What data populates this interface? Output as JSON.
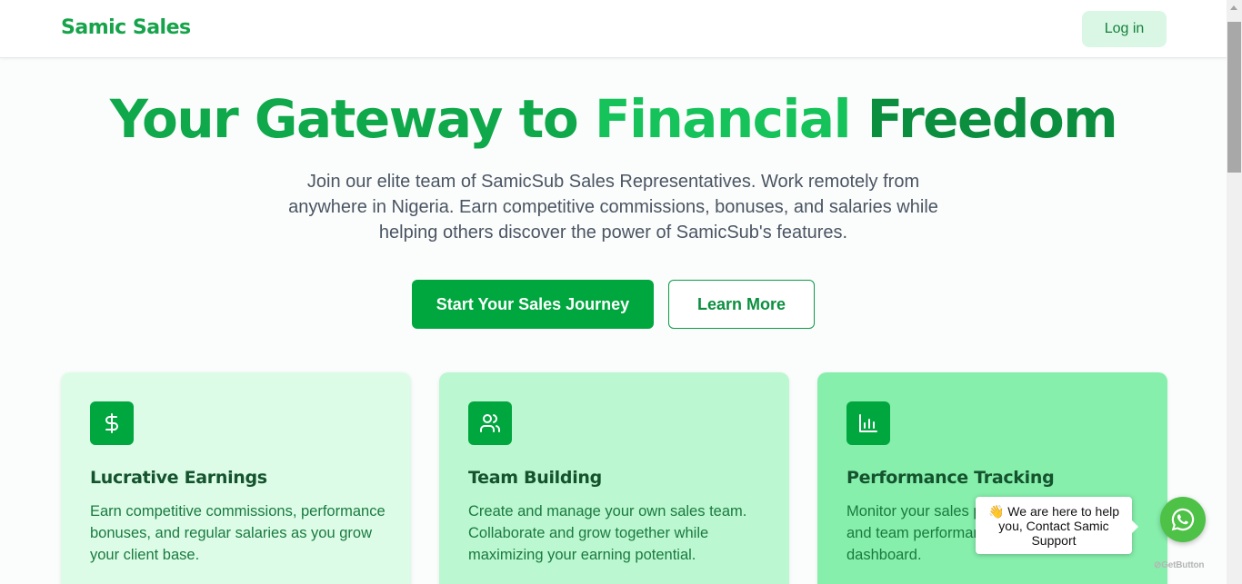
{
  "header": {
    "brand": "Samic Sales",
    "login_label": "Log in"
  },
  "hero": {
    "title_part1": "Your Gateway to ",
    "title_part2": "Financial",
    "title_part3": " Freedom",
    "subtitle": "Join our elite team of SamicSub Sales Representatives. Work remotely from anywhere in Nigeria. Earn competitive commissions, bonuses, and salaries while helping others discover the power of SamicSub's features.",
    "primary_cta": "Start Your Sales Journey",
    "secondary_cta": "Learn More"
  },
  "features": [
    {
      "icon": "dollar-icon",
      "title": "Lucrative Earnings",
      "description": "Earn competitive commissions, performance bonuses, and regular salaries as you grow your client base."
    },
    {
      "icon": "users-icon",
      "title": "Team Building",
      "description": "Create and manage your own sales team. Collaborate and grow together while maximizing your earning potential."
    },
    {
      "icon": "bar-chart-icon",
      "title": "Performance Tracking",
      "description": "Monitor your sales progress, commissions, and team performance through an intuitive dashboard."
    }
  ],
  "chat_widget": {
    "message": "👋 We are here to help you, Contact Samic Support",
    "powered_by": "GetButton"
  },
  "colors": {
    "brand_green": "#16a34a",
    "primary_button": "#00a63e",
    "card1_bg": "#dcfce7",
    "card2_bg": "#bbf7d0",
    "card3_bg": "#86efac",
    "whatsapp_green": "#4dc247"
  }
}
